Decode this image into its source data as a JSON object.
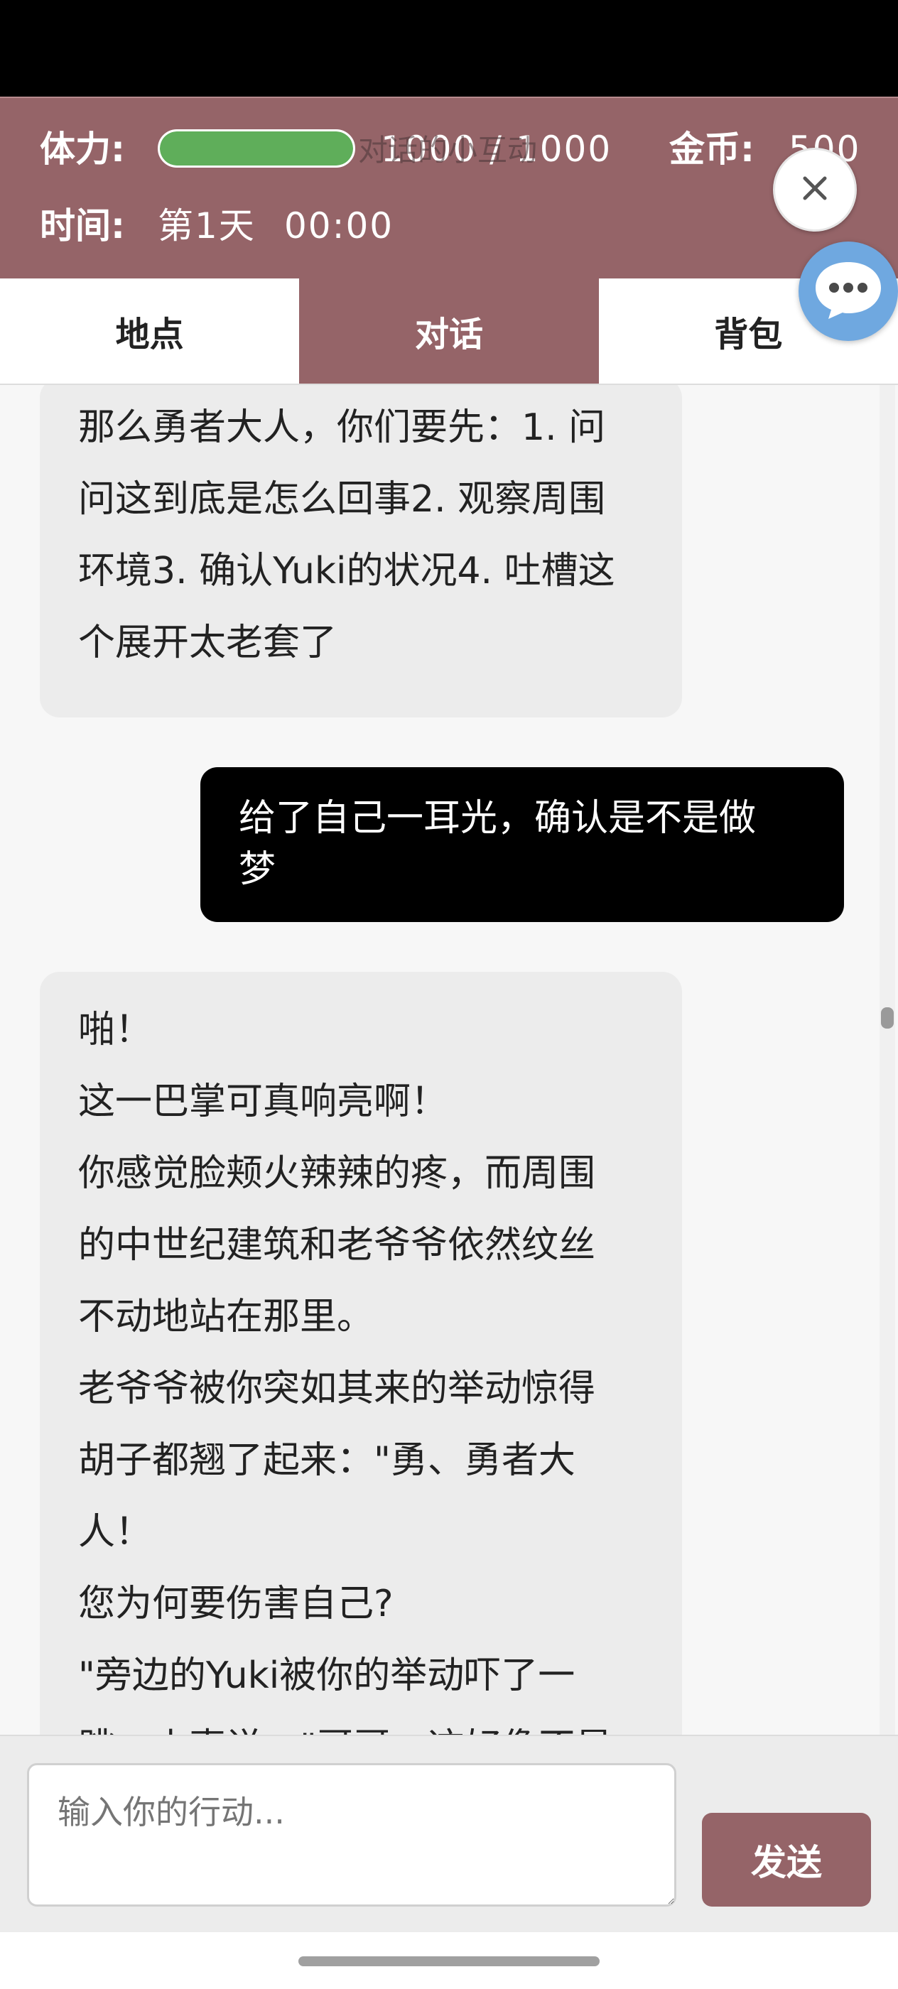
{
  "header": {
    "stamina_label": "体力:",
    "stamina_value": "1000 / 1000",
    "stamina_fraction": 1.0,
    "gold_label": "金币:",
    "gold_value": "500",
    "time_label": "时间:",
    "time_day": "第1天",
    "time_clock": "00:00",
    "overlay_title": "对话的小互动"
  },
  "tabs": [
    {
      "label": "地点",
      "active": false
    },
    {
      "label": "对话",
      "active": true
    },
    {
      "label": "背包",
      "active": false
    }
  ],
  "messages": [
    {
      "role": "ai",
      "text": "那么勇者大人，你们要先：1. 问\n问这到底是怎么回事2. 观察周围\n环境3. 确认Yuki的状况4. 吐槽这\n个展开太老套了"
    },
    {
      "role": "user",
      "text": "给了自己一耳光，确认是不是做\n梦"
    },
    {
      "role": "ai",
      "text": "啪！\n这一巴掌可真响亮啊！\n你感觉脸颊火辣辣的疼，而周围\n的中世纪建筑和老爷爷依然纹丝\n不动地站在那里。\n老爷爷被你突如其来的举动惊得\n胡子都翘了起来：\"勇、勇者大\n人！\n您为何要伤害自己?\n\"旁边的Yuki被你的举动吓了一\n跳，小声说：\"哥哥，这好像不是"
    }
  ],
  "input": {
    "placeholder": "输入你的行动...",
    "send_label": "发送"
  },
  "icons": {
    "close": "close-icon",
    "chat": "chat-bubble-icon"
  },
  "colors": {
    "accent": "#956468",
    "stamina": "#5fae5a",
    "chat_fab": "#6fa8e0"
  }
}
